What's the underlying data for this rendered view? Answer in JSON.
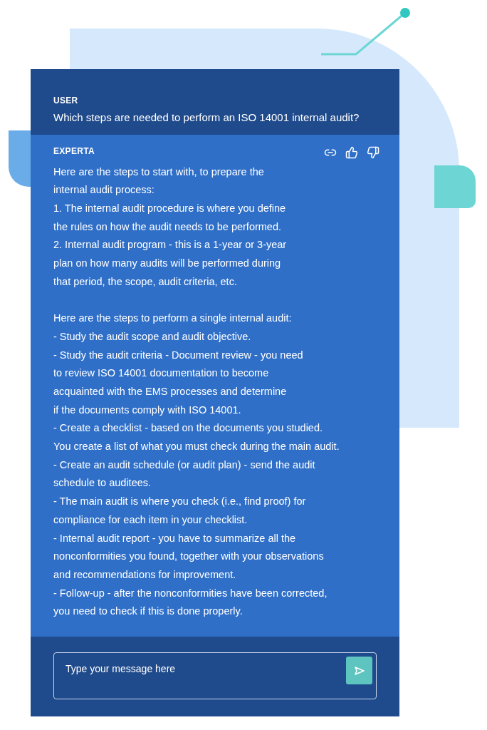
{
  "user": {
    "label": "USER",
    "message": "Which steps are needed to perform an ISO 14001 internal audit?"
  },
  "assistant": {
    "label": "EXPERTA",
    "sections": [
      [
        [
          "Here are the steps to start with, to prepare the",
          "internal audit process:"
        ],
        [
          "1. The internal audit procedure is where you define",
          "the rules on how the audit needs to be performed."
        ],
        [
          "2. Internal audit program - this is a 1-year or 3-year",
          "plan on how many audits will be performed during",
          "that period, the scope, audit criteria, etc."
        ]
      ],
      [
        [
          "Here are the steps to perform a single internal audit:"
        ],
        [
          "- Study the audit scope and audit objective."
        ],
        [
          "- Study the audit criteria - Document review - you need",
          "to review ISO 14001 documentation to become",
          "acquainted with the EMS processes and determine",
          "if the documents comply with ISO 14001."
        ],
        [
          "- Create a checklist - based on the documents you studied.",
          "You create a list of what you must check during the main audit."
        ],
        [
          "- Create an audit schedule (or audit plan) - send the audit",
          "schedule to auditees."
        ],
        [
          "- The main audit is where you check (i.e., find proof) for",
          "compliance for each item in your checklist."
        ],
        [
          "- Internal audit report - you have to summarize all the",
          "nonconformities you found, together with your observations",
          "and recommendations for improvement."
        ],
        [
          "- Follow-up - after the nonconformities have been corrected,",
          "you need to check if this is done properly."
        ]
      ]
    ]
  },
  "composer": {
    "placeholder": "Type your message here"
  }
}
